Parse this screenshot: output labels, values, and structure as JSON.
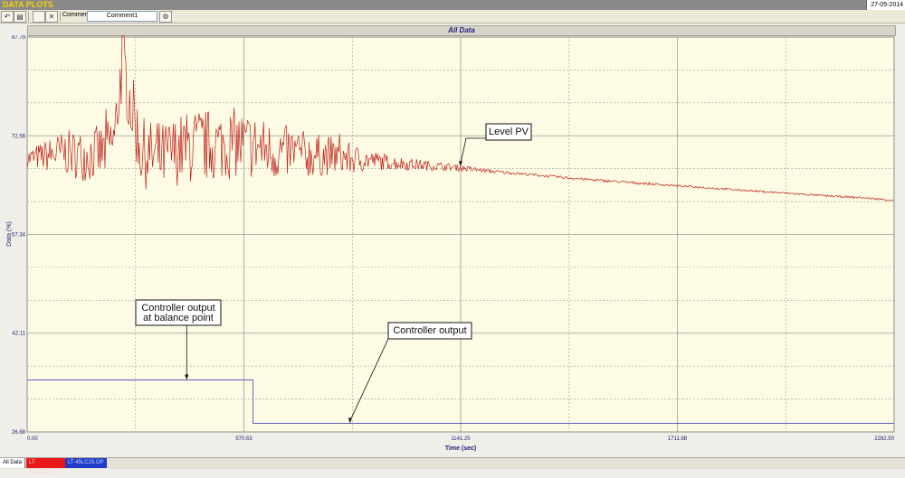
{
  "window": {
    "title": "DATA PLOTS",
    "date": "27-05-2014"
  },
  "toolbar": {
    "comment_label": "Comment",
    "comment_value": "Comment1"
  },
  "tabs": [
    "All Data",
    "LT-45LC23.PV",
    "LT-45LC23.OP"
  ],
  "chart_data": {
    "type": "line",
    "title": "All Data",
    "xlabel": "Time (sec)",
    "ylabel": "Data (%)",
    "xlim": [
      0,
      2282.5
    ],
    "ylim": [
      26.88,
      87.79
    ],
    "xticks": [
      "0.00",
      "570.63",
      "1141.25",
      "1711.88",
      "2282.50"
    ],
    "yticks": [
      "26.88",
      "42.11",
      "57.34",
      "72.56",
      "87.79"
    ],
    "grid": true,
    "series": [
      {
        "name": "LT-45LC23.PV",
        "color": "#c0201a",
        "x": [
          0,
          50,
          100,
          150,
          200,
          230,
          250,
          300,
          350,
          400,
          450,
          500,
          550,
          570,
          600,
          650,
          700,
          750,
          800,
          850,
          900,
          950,
          1000,
          1050,
          1100,
          1141,
          1200,
          1300,
          1400,
          1500,
          1600,
          1700,
          1800,
          1900,
          2000,
          2100,
          2200,
          2282
        ],
        "y": [
          69,
          69.5,
          70,
          69.5,
          70,
          72,
          84,
          70,
          69,
          70.5,
          71,
          71,
          71.5,
          71,
          71,
          70,
          70,
          69.5,
          69.5,
          69,
          68.8,
          68.5,
          68.2,
          68,
          67.8,
          67.6,
          67.2,
          66.7,
          66.2,
          65.7,
          65.3,
          64.9,
          64.5,
          64.1,
          63.7,
          63.3,
          63,
          62.6
        ],
        "noise_amplitude": [
          1.5,
          2.5,
          3.5,
          4.0,
          4.5,
          5.0,
          6.0,
          5.5,
          5.5,
          5.5,
          6.0,
          5.5,
          5.5,
          5.5,
          5.0,
          4.5,
          4.0,
          3.5,
          3.0,
          2.5,
          1.6,
          1.2,
          1.0,
          0.8,
          0.6,
          0.5,
          0.3,
          0.2,
          0.2,
          0.2,
          0.2,
          0.15,
          0.15,
          0.15,
          0.15,
          0.15,
          0.15,
          0.15
        ]
      },
      {
        "name": "LT-45LC23.OP",
        "color": "#2a2ab0",
        "x": [
          0,
          595,
          595,
          2282.5
        ],
        "y": [
          34.9,
          34.9,
          28.2,
          28.2
        ]
      }
    ],
    "annotations": [
      {
        "text": "Level PV",
        "x": 1141,
        "y": 67.8
      },
      {
        "text": "Controller output\nat balance point",
        "x": 420,
        "y": 34.9
      },
      {
        "text": "Controller output",
        "x": 855,
        "y": 28.2
      }
    ]
  }
}
